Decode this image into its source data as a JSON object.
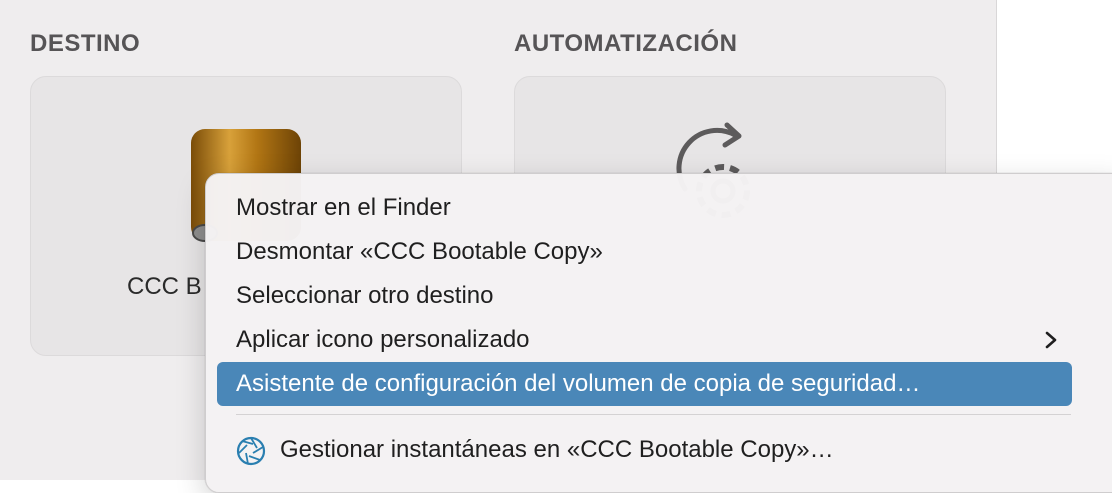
{
  "sections": {
    "destination_title": "DESTINO",
    "automation_title": "AUTOMATIZACIÓN"
  },
  "destination_card": {
    "label": "CCC B"
  },
  "context_menu": {
    "items": [
      {
        "label": "Mostrar en el Finder"
      },
      {
        "label": "Desmontar «CCC Bootable Copy»"
      },
      {
        "label": "Seleccionar otro destino"
      },
      {
        "label": "Aplicar icono personalizado",
        "has_submenu": true
      },
      {
        "label": "Asistente de configuración del volumen de copia de seguridad…",
        "highlighted": true
      },
      {
        "label": "Gestionar instantáneas en «CCC Bootable Copy»…",
        "icon": "aperture-icon"
      }
    ]
  },
  "colors": {
    "highlight": "#4a87b8",
    "window_bg": "#efedee",
    "drive_gold": "#b8801a",
    "snapshot_icon": "#2a7fb0"
  }
}
